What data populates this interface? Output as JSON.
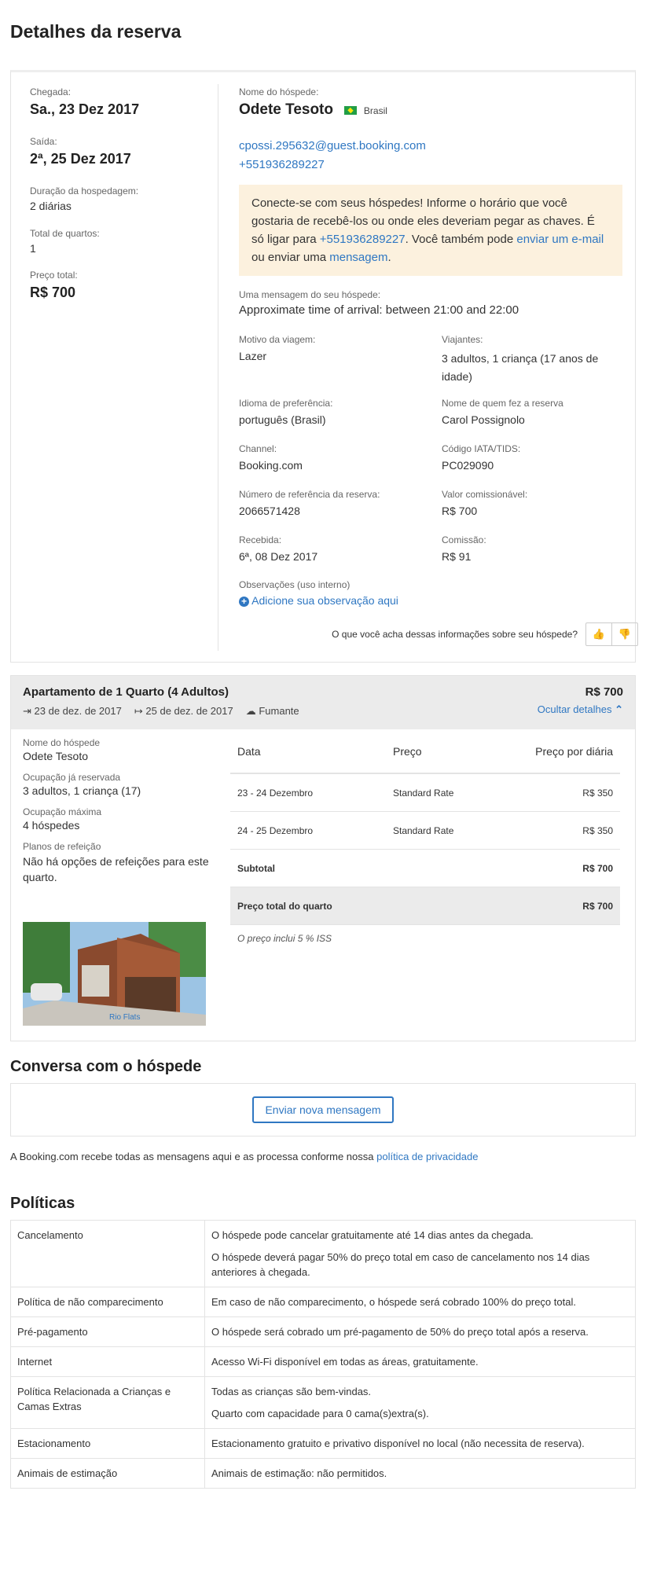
{
  "page_title": "Detalhes da reserva",
  "booking": {
    "arrival_label": "Chegada:",
    "arrival_value": "Sa., 23 Dez 2017",
    "departure_label": "Saída:",
    "departure_value": "2ª, 25 Dez 2017",
    "duration_label": "Duração da hospedagem:",
    "duration_value": "2 diárias",
    "rooms_label": "Total de quartos:",
    "rooms_value": "1",
    "price_label": "Preço total:",
    "price_value": "R$ 700"
  },
  "guest": {
    "name_label": "Nome do hóspede:",
    "name": "Odete Tesoto",
    "country": "Brasil",
    "email": "cpossi.295632@guest.booking.com",
    "phone": "+551936289227",
    "notice": {
      "text1": "Conecte-se com seus hóspedes! Informe o horário que você gostaria de recebê-los ou onde eles deveriam pegar as chaves. É só ligar para ",
      "phone": "+551936289227",
      "text2": ". Você também pode ",
      "email_link": "enviar um e-mail",
      "text3": " ou enviar uma ",
      "message_link": "mensagem",
      "text4": "."
    },
    "message_label": "Uma mensagem do seu hóspede:",
    "message": "Approximate time of arrival: between 21:00 and 22:00",
    "fields": {
      "reason_label": "Motivo da viagem:",
      "reason": "Lazer",
      "travellers_label": "Viajantes:",
      "travellers": "3 adultos, 1 criança (17 anos de idade)",
      "language_label": "Idioma de preferência:",
      "language": "português (Brasil)",
      "booker_label": "Nome de quem fez a reserva",
      "booker": "Carol Possignolo",
      "channel_label": "Channel:",
      "channel": "Booking.com",
      "iata_label": "Código IATA/TIDS:",
      "iata": "PC029090",
      "ref_label": "Número de referência da reserva:",
      "ref": "2066571428",
      "commissionable_label": "Valor comissionável:",
      "commissionable": "R$ 700",
      "received_label": "Recebida:",
      "received": "6ª, 08 Dez 2017",
      "commission_label": "Comissão:",
      "commission": "R$ 91"
    },
    "notes_label": "Observações (uso interno)",
    "add_note": "Adicione sua observação aqui",
    "feedback_question": "O que você acha dessas informações sobre seu hóspede?"
  },
  "room": {
    "title": "Apartamento de 1 Quarto (4 Adultos)",
    "checkin": "23 de dez. de 2017",
    "checkout": "25 de dez. de 2017",
    "smoking": "Fumante",
    "price": "R$ 700",
    "hide_details": "Ocultar detalhes",
    "guest_label": "Nome do hóspede",
    "guest_name": "Odete Tesoto",
    "occupancy_label": "Ocupação já reservada",
    "occupancy": "3 adultos, 1 criança (17)",
    "max_label": "Ocupação máxima",
    "max": "4 hóspedes",
    "meal_label": "Planos de refeição",
    "meal": "Não há opções de refeições para este quarto.",
    "photo_watermark": "Rio Flats",
    "rates": {
      "headers": [
        "Data",
        "Preço",
        "Preço por diária"
      ],
      "rows": [
        {
          "date": "23 - 24 Dezembro",
          "rate": "Standard Rate",
          "price": "R$ 350"
        },
        {
          "date": "24 - 25 Dezembro",
          "rate": "Standard Rate",
          "price": "R$ 350"
        }
      ],
      "subtotal_label": "Subtotal",
      "subtotal": "R$ 700",
      "total_label": "Preço total do quarto",
      "total": "R$ 700",
      "tax_note": "O preço inclui 5 % ISS"
    }
  },
  "conversation": {
    "title": "Conversa com o hóspede",
    "button": "Enviar nova mensagem",
    "privacy_text": "A Booking.com recebe todas as mensagens aqui e as processa conforme nossa ",
    "privacy_link": "política de privacidade"
  },
  "policies": {
    "title": "Políticas",
    "rows": [
      {
        "key": "Cancelamento",
        "lines": [
          "O hóspede pode cancelar gratuitamente até 14 dias antes da chegada.",
          "O hóspede deverá pagar 50% do preço total em caso de cancelamento nos 14 dias anteriores à chegada."
        ]
      },
      {
        "key": "Política de não comparecimento",
        "lines": [
          "Em caso de não comparecimento, o hóspede será cobrado 100% do preço total."
        ]
      },
      {
        "key": "Pré-pagamento",
        "lines": [
          "O hóspede será cobrado um pré-pagamento de 50% do preço total após a reserva."
        ]
      },
      {
        "key": "Internet",
        "lines": [
          "Acesso Wi-Fi disponível em todas as áreas, gratuitamente."
        ]
      },
      {
        "key": "Política Relacionada a Crianças e Camas Extras",
        "lines": [
          "Todas as crianças são bem-vindas.",
          "Quarto com capacidade para 0 cama(s)extra(s)."
        ]
      },
      {
        "key": "Estacionamento",
        "lines": [
          "Estacionamento gratuito e privativo disponível no local (não necessita de reserva)."
        ]
      },
      {
        "key": "Animais de estimação",
        "lines": [
          "Animais de estimação: não permitidos."
        ]
      }
    ]
  }
}
